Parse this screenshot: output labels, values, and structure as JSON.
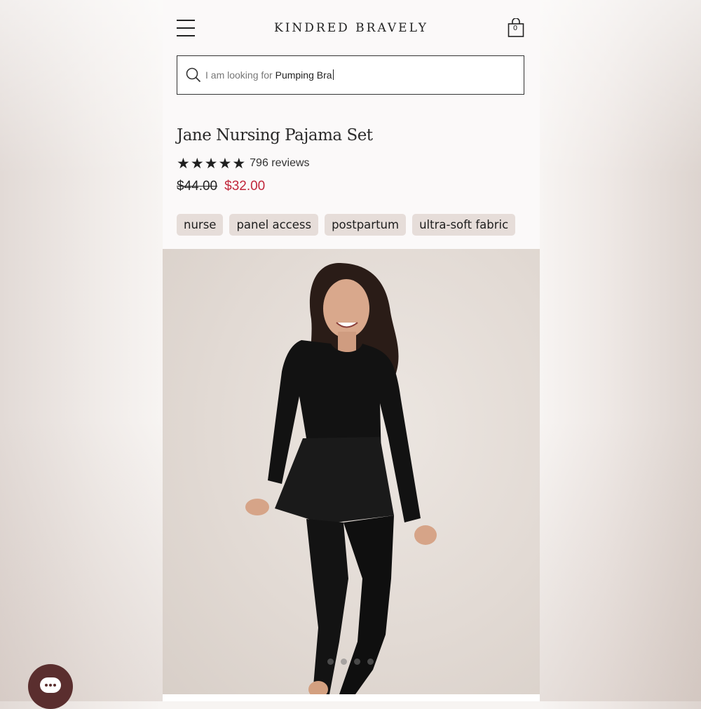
{
  "header": {
    "brand": "KINDRED BRAVELY",
    "menu_icon": "hamburger-menu-icon",
    "cart_icon": "shopping-bag-icon",
    "cart_count": "0"
  },
  "search": {
    "prefix": "I am looking for",
    "typed_value": "Pumping Bra",
    "icon": "search-icon"
  },
  "product": {
    "title": "Jane Nursing Pajama Set",
    "rating_stars": 5,
    "reviews": "796 reviews",
    "price_original": "$44.00",
    "price_sale": "$32.00",
    "tags": [
      "nurse",
      "panel access",
      "postpartum",
      "ultra-soft fabric"
    ]
  },
  "gallery": {
    "slide_count": 4,
    "active_slide": 1
  },
  "chat": {
    "icon": "chat-bubble-icon"
  },
  "colors": {
    "sale_price": "#c1273b",
    "tag_background": "#e6ddd9",
    "chat_button": "#5a2e2e",
    "header_background": "#fbf9f9"
  }
}
